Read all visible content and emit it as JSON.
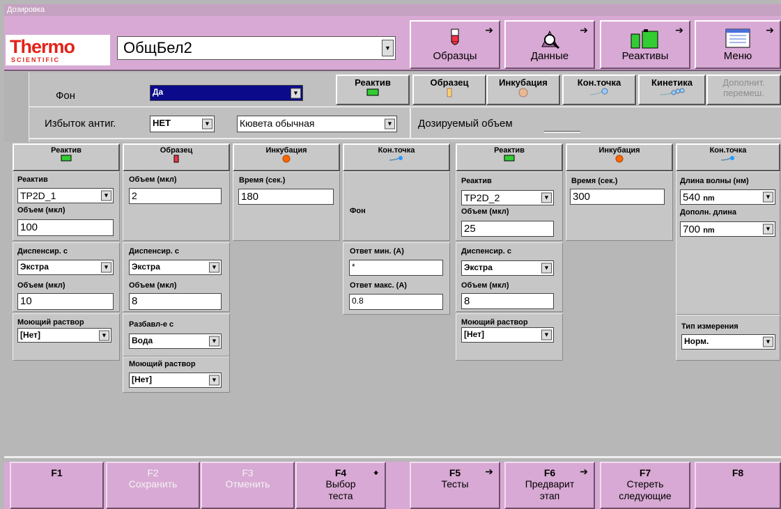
{
  "window": {
    "title": "Дозировка"
  },
  "logo": {
    "main": "Thermo",
    "sub": "SCIENTIFIC"
  },
  "test": {
    "selected": "ОбщБел2"
  },
  "nav": {
    "samples": "Образцы",
    "data": "Данные",
    "reagents": "Реактивы",
    "menu": "Меню"
  },
  "background": {
    "label": "Фон",
    "value": "Да"
  },
  "antigen_excess": {
    "label": "Избыток антиг.",
    "value": "НЕТ"
  },
  "cuvette": {
    "value": "Кювета обычная"
  },
  "dispensed_volume": {
    "label": "Дозируемый объем"
  },
  "tabs": {
    "reagent": "Реактив",
    "sample": "Образец",
    "incubation": "Инкубация",
    "endpoint": "Кон.точка",
    "kinetics": "Кинетика",
    "extra_mix_1": "Дополнит.",
    "extra_mix_2": "перемеш."
  },
  "col1": {
    "head": "Реактив",
    "reagent_label": "Реактив",
    "reagent_value": "TP2D_1",
    "volume_label": "Объем (мкл)",
    "volume_value": "100",
    "dispense_label": "Диспенсир. с",
    "dispense_value": "Экстра",
    "volume2_label": "Объем (мкл)",
    "volume2_value": "10",
    "wash_label": "Моющий раствор",
    "wash_value": "[Нет]"
  },
  "col2": {
    "head": "Образец",
    "volume_label": "Объем (мкл)",
    "volume_value": "2",
    "dispense_label": "Диспенсир. с",
    "dispense_value": "Экстра",
    "volume2_label": "Объем (мкл)",
    "volume2_value": "8",
    "dilution_label": "Разбавл-е с",
    "dilution_value": "Вода",
    "wash_label": "Моющий раствор",
    "wash_value": "[Нет]"
  },
  "col3": {
    "head": "Инкубация",
    "time_label": "Время (сек.)",
    "time_value": "180"
  },
  "col4": {
    "head": "Кон.точка",
    "blank_label": "Фон",
    "resp_min_label": "Ответ мин. (А)",
    "resp_min_value": "*",
    "resp_max_label": "Ответ макс. (А)",
    "resp_max_value": "0.8"
  },
  "col5": {
    "head": "Реактив",
    "reagent_label": "Реактив",
    "reagent_value": "TP2D_2",
    "volume_label": "Объем (мкл)",
    "volume_value": "25",
    "dispense_label": "Диспенсир. с",
    "dispense_value": "Экстра",
    "volume2_label": "Объем (мкл)",
    "volume2_value": "8",
    "wash_label": "Моющий раствор",
    "wash_value": "[Нет]"
  },
  "col6": {
    "head": "Инкубация",
    "time_label": "Время (сек.)",
    "time_value": "300"
  },
  "col7": {
    "head": "Кон.точка",
    "wl_label": "Длина волны (нм)",
    "wl_value": "540",
    "wl_unit": "nm",
    "wl2_label": "Дополн. длина",
    "wl2_value": "700",
    "wl2_unit": "nm",
    "meas_label": "Тип измерения",
    "meas_value": "Норм."
  },
  "fkeys": {
    "f1": "F1",
    "f2": "F2",
    "f2_text": "Сохранить",
    "f3": "F3",
    "f3_text": "Отменить",
    "f4": "F4",
    "f4_text1": "Выбор",
    "f4_text2": "теста",
    "f5": "F5",
    "f5_text": "Тесты",
    "f6": "F6",
    "f6_text1": "Предварит",
    "f6_text2": "этап",
    "f7": "F7",
    "f7_text1": "Стереть",
    "f7_text2": "следующие",
    "f8": "F8"
  }
}
